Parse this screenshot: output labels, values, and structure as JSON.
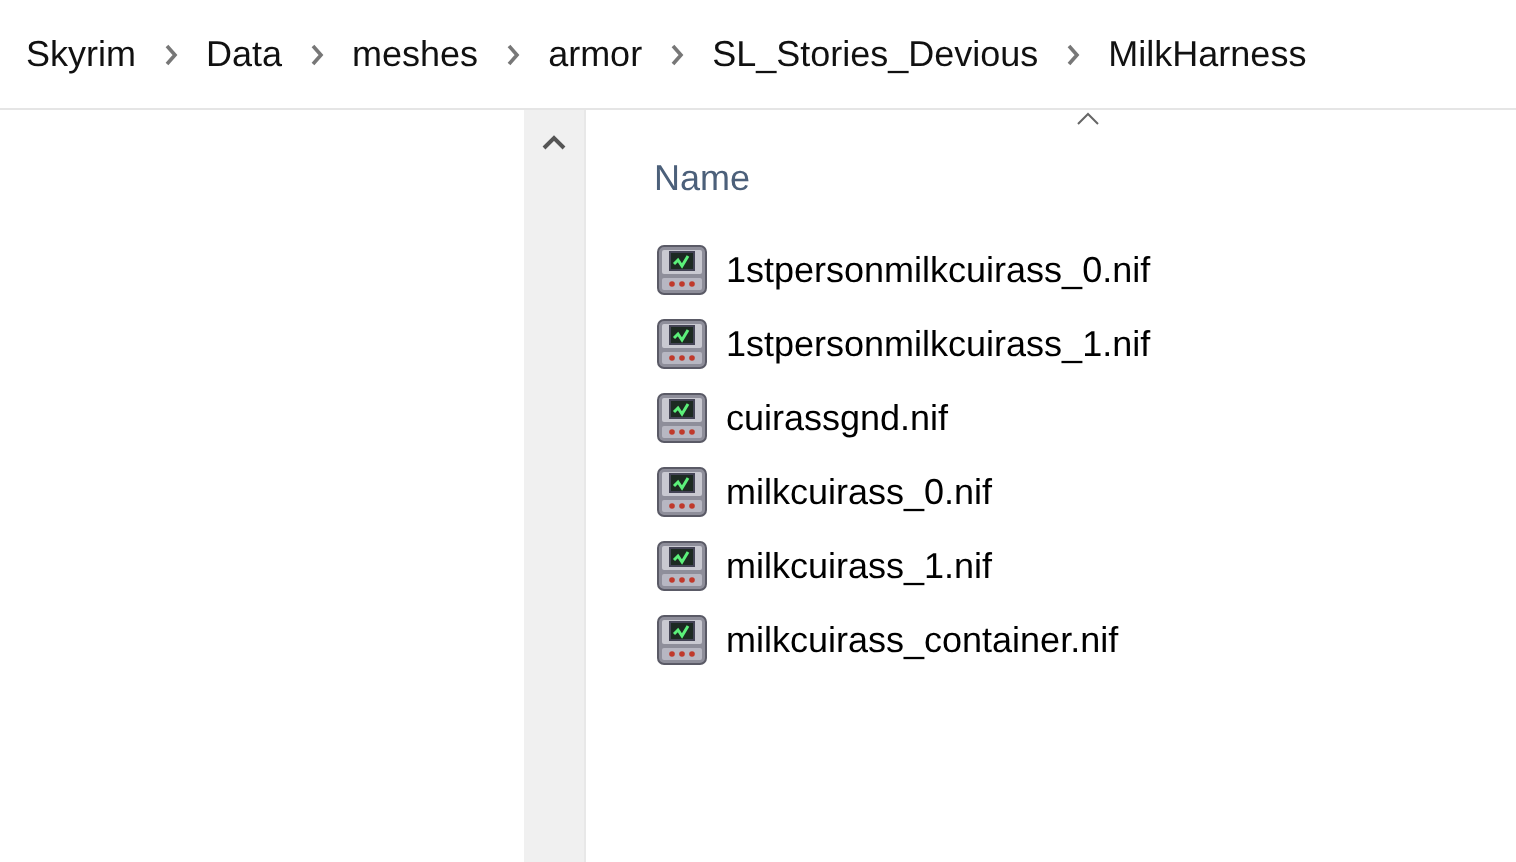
{
  "breadcrumb": [
    "Skyrim",
    "Data",
    "meshes",
    "armor",
    "SL_Stories_Devious",
    "MilkHarness"
  ],
  "file_list": {
    "columns": [
      {
        "label": "Name",
        "sorted": true
      }
    ],
    "files": [
      {
        "name": "1stpersonmilkcuirass_0.nif"
      },
      {
        "name": "1stpersonmilkcuirass_1.nif"
      },
      {
        "name": "cuirassgnd.nif"
      },
      {
        "name": "milkcuirass_0.nif"
      },
      {
        "name": "milkcuirass_1.nif"
      },
      {
        "name": "milkcuirass_container.nif"
      }
    ]
  }
}
